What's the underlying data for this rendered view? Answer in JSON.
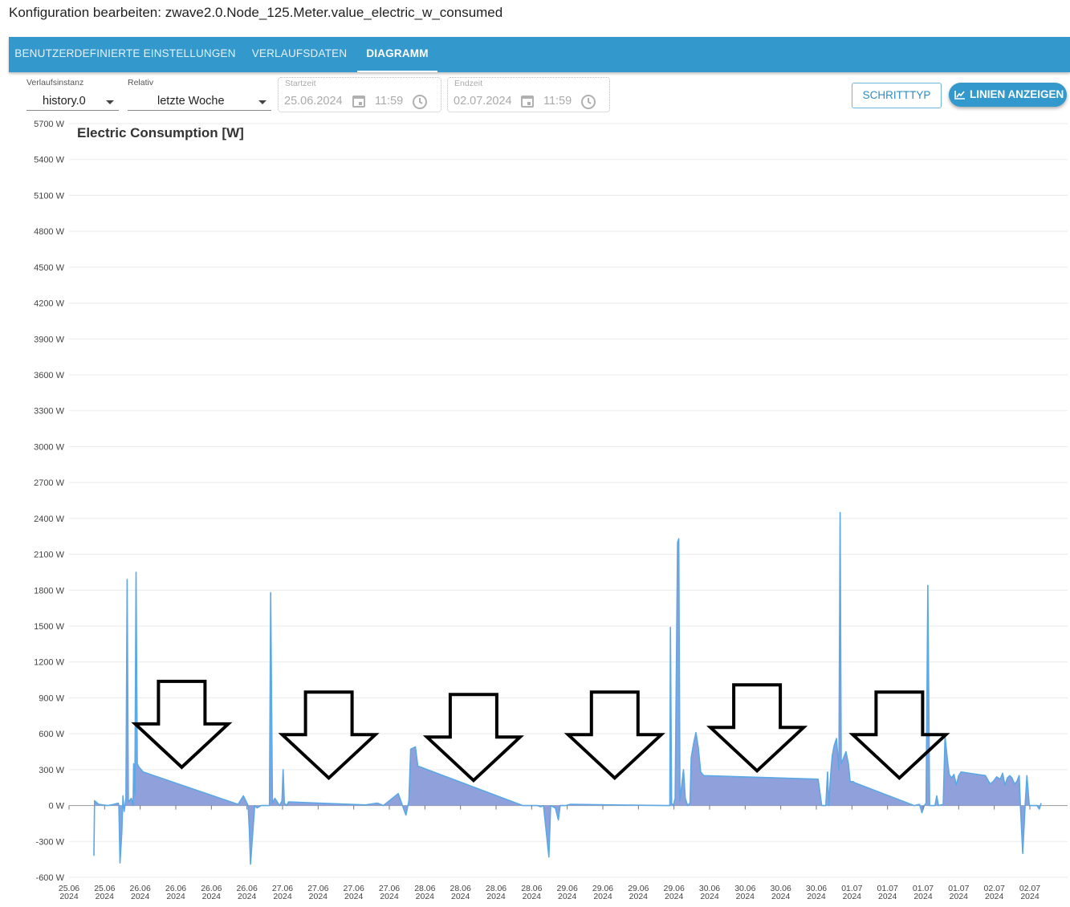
{
  "dialog": {
    "title": "Konfiguration bearbeiten: zwave2.0.Node_125.Meter.value_electric_w_consumed"
  },
  "tabs": [
    {
      "label": "BENUTZERDEFINIERTE EINSTELLUNGEN",
      "active": false
    },
    {
      "label": "VERLAUFSDATEN",
      "active": false
    },
    {
      "label": "DIAGRAMM",
      "active": true
    }
  ],
  "controls": {
    "instance": {
      "label": "Verlaufsinstanz",
      "value": "history.0"
    },
    "relative": {
      "label": "Relativ",
      "value": "letzte Woche"
    },
    "start": {
      "label": "Startzeit",
      "date": "25.06.2024",
      "time": "11:59"
    },
    "end": {
      "label": "Endzeit",
      "date": "02.07.2024",
      "time": "11:59"
    },
    "font_button": "SCHRITTTYP",
    "lines_button": "LINIEN ANZEIGEN"
  },
  "icons": {
    "calendar": "calendar-icon",
    "clock": "clock-icon",
    "lines": "line-chart-icon",
    "annotation": "down-arrow-annotation"
  },
  "colors": {
    "tabbar": "#3399cc",
    "series_line": "#5aa8e6",
    "series_fill": "#8a9bd9",
    "annotation": "#000000"
  },
  "chart_data": {
    "type": "area",
    "title": "Electric Consumption [W]",
    "unit": "W",
    "ylim": [
      -600,
      5700
    ],
    "y_ticks": [
      -600,
      -300,
      0,
      300,
      600,
      900,
      1200,
      1500,
      1800,
      2100,
      2400,
      2700,
      3000,
      3300,
      3600,
      3900,
      4200,
      4500,
      4800,
      5100,
      5400,
      5700
    ],
    "y_tick_labels": [
      "-600 W",
      "-300 W",
      "0 W",
      "300 W",
      "600 W",
      "900 W",
      "1200 W",
      "1500 W",
      "1800 W",
      "2100 W",
      "2400 W",
      "2700 W",
      "3000 W",
      "3300 W",
      "3600 W",
      "3900 W",
      "4200 W",
      "4500 W",
      "4800 W",
      "5100 W",
      "5400 W",
      "5700 W"
    ],
    "x_range_hours": [
      0,
      168
    ],
    "x_ticks_hours": [
      0,
      6,
      12,
      18,
      24,
      30,
      36,
      42,
      48,
      54,
      60,
      66,
      72,
      78,
      84,
      90,
      96,
      102,
      108,
      114,
      120,
      126,
      132,
      138,
      144,
      150,
      156,
      162
    ],
    "x_tick_labels": [
      [
        "25.06",
        "2024"
      ],
      [
        "25.06",
        "2024"
      ],
      [
        "26.06",
        "2024"
      ],
      [
        "26.06",
        "2024"
      ],
      [
        "26.06",
        "2024"
      ],
      [
        "26.06",
        "2024"
      ],
      [
        "27.06",
        "2024"
      ],
      [
        "27.06",
        "2024"
      ],
      [
        "27.06",
        "2024"
      ],
      [
        "27.06",
        "2024"
      ],
      [
        "28.06",
        "2024"
      ],
      [
        "28.06",
        "2024"
      ],
      [
        "28.06",
        "2024"
      ],
      [
        "28.06",
        "2024"
      ],
      [
        "29.06",
        "2024"
      ],
      [
        "29.06",
        "2024"
      ],
      [
        "29.06",
        "2024"
      ],
      [
        "29.06",
        "2024"
      ],
      [
        "30.06",
        "2024"
      ],
      [
        "30.06",
        "2024"
      ],
      [
        "30.06",
        "2024"
      ],
      [
        "30.06",
        "2024"
      ],
      [
        "01.07",
        "2024"
      ],
      [
        "01.07",
        "2024"
      ],
      [
        "01.07",
        "2024"
      ],
      [
        "01.07",
        "2024"
      ],
      [
        "02.07",
        "2024"
      ],
      [
        "02.07",
        "2024"
      ]
    ],
    "grid": true,
    "series": [
      {
        "points": [
          [
            4.2,
            -420
          ],
          [
            4.3,
            40
          ],
          [
            5,
            10
          ],
          [
            6.5,
            0
          ],
          [
            7.5,
            10
          ],
          [
            8.3,
            20
          ],
          [
            8.4,
            0
          ],
          [
            8.6,
            -480
          ],
          [
            8.9,
            -220
          ],
          [
            9.1,
            80
          ],
          [
            9.3,
            -50
          ],
          [
            9.6,
            60
          ],
          [
            9.8,
            1890
          ],
          [
            10.0,
            30
          ],
          [
            10.5,
            60
          ],
          [
            10.8,
            0
          ],
          [
            10.9,
            350
          ],
          [
            11.1,
            90
          ],
          [
            11.3,
            1950
          ],
          [
            11.5,
            350
          ],
          [
            11.8,
            320
          ],
          [
            12.5,
            280
          ],
          [
            28.5,
            10
          ],
          [
            29.4,
            80
          ],
          [
            30.2,
            0
          ],
          [
            30.4,
            -200
          ],
          [
            30.6,
            -490
          ],
          [
            31.3,
            0
          ],
          [
            31.7,
            -20
          ],
          [
            32.4,
            0
          ],
          [
            33.8,
            0
          ],
          [
            34.0,
            1780
          ],
          [
            34.3,
            20
          ],
          [
            34.7,
            60
          ],
          [
            35.5,
            0
          ],
          [
            35.9,
            40
          ],
          [
            36.1,
            300
          ],
          [
            36.3,
            20
          ],
          [
            36.7,
            0
          ],
          [
            37.0,
            30
          ],
          [
            50.0,
            5
          ],
          [
            52.0,
            20
          ],
          [
            53.0,
            0
          ],
          [
            55.5,
            100
          ],
          [
            56.5,
            -40
          ],
          [
            56.8,
            -80
          ],
          [
            57.3,
            40
          ],
          [
            57.6,
            470
          ],
          [
            58.4,
            490
          ],
          [
            58.8,
            330
          ],
          [
            76.5,
            0
          ],
          [
            79.0,
            0
          ],
          [
            79.5,
            -10
          ],
          [
            80.0,
            0
          ],
          [
            80.9,
            -430
          ],
          [
            81.2,
            0
          ],
          [
            82.0,
            -20
          ],
          [
            82.5,
            -120
          ],
          [
            82.8,
            0
          ],
          [
            83.7,
            0
          ],
          [
            84.5,
            10
          ],
          [
            100.7,
            0
          ],
          [
            101.3,
            0
          ],
          [
            101.4,
            1490
          ],
          [
            101.6,
            20
          ],
          [
            101.9,
            0
          ],
          [
            102.2,
            60
          ],
          [
            102.6,
            2200
          ],
          [
            102.8,
            2230
          ],
          [
            103.0,
            40
          ],
          [
            103.6,
            300
          ],
          [
            103.9,
            60
          ],
          [
            104.3,
            0
          ],
          [
            104.7,
            20
          ],
          [
            104.9,
            400
          ],
          [
            105.3,
            520
          ],
          [
            105.7,
            610
          ],
          [
            106.1,
            480
          ],
          [
            106.5,
            280
          ],
          [
            107.0,
            250
          ],
          [
            126.3,
            220
          ],
          [
            126.9,
            0
          ],
          [
            127.6,
            0
          ],
          [
            127.9,
            280
          ],
          [
            128.1,
            0
          ],
          [
            128.4,
            250
          ],
          [
            128.7,
            420
          ],
          [
            129.0,
            500
          ],
          [
            129.4,
            560
          ],
          [
            129.8,
            300
          ],
          [
            130.0,
            2450
          ],
          [
            130.2,
            350
          ],
          [
            130.6,
            400
          ],
          [
            131.0,
            450
          ],
          [
            131.4,
            350
          ],
          [
            131.7,
            200
          ],
          [
            132.2,
            200
          ],
          [
            132.5,
            190
          ],
          [
            142.5,
            0
          ],
          [
            143.4,
            10
          ],
          [
            143.8,
            -60
          ],
          [
            144.2,
            0
          ],
          [
            144.5,
            20
          ],
          [
            144.8,
            1840
          ],
          [
            145.1,
            0
          ],
          [
            146.0,
            0
          ],
          [
            146.3,
            80
          ],
          [
            146.6,
            0
          ],
          [
            147.4,
            10
          ],
          [
            147.7,
            580
          ],
          [
            148.1,
            380
          ],
          [
            148.4,
            260
          ],
          [
            148.8,
            230
          ],
          [
            149.2,
            260
          ],
          [
            149.6,
            170
          ],
          [
            150.0,
            250
          ],
          [
            150.4,
            280
          ],
          [
            154.5,
            250
          ],
          [
            155.3,
            180
          ],
          [
            155.8,
            200
          ],
          [
            156.4,
            240
          ],
          [
            157.0,
            220
          ],
          [
            157.4,
            270
          ],
          [
            157.8,
            170
          ],
          [
            158.2,
            230
          ],
          [
            158.6,
            250
          ],
          [
            159.0,
            230
          ],
          [
            159.4,
            180
          ],
          [
            159.8,
            200
          ],
          [
            160.2,
            250
          ],
          [
            160.4,
            0
          ],
          [
            160.8,
            -400
          ],
          [
            161.2,
            0
          ],
          [
            161.5,
            250
          ],
          [
            161.9,
            0
          ],
          [
            162.5,
            0
          ],
          [
            163.2,
            0
          ],
          [
            163.6,
            -30
          ],
          [
            163.9,
            20
          ]
        ]
      }
    ],
    "annotations": [
      {
        "type": "down-arrow",
        "x_hours": 19.0,
        "bottom_value": 320
      },
      {
        "type": "down-arrow",
        "x_hours": 43.8,
        "bottom_value": 230
      },
      {
        "type": "down-arrow",
        "x_hours": 68.2,
        "bottom_value": 210
      },
      {
        "type": "down-arrow",
        "x_hours": 92.0,
        "bottom_value": 230
      },
      {
        "type": "down-arrow",
        "x_hours": 116.0,
        "bottom_value": 290
      },
      {
        "type": "down-arrow",
        "x_hours": 140.0,
        "bottom_value": 230
      }
    ]
  }
}
